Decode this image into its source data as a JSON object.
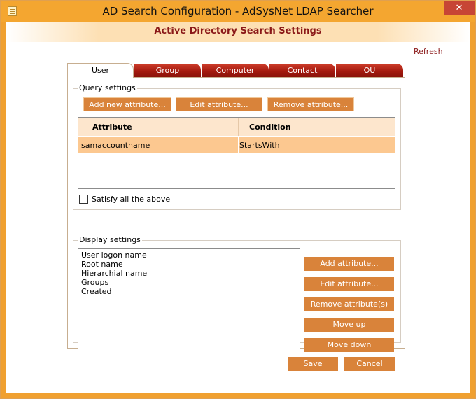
{
  "window": {
    "title": "AD Search Configuration - AdSysNet LDAP Searcher",
    "close_glyph": "✕"
  },
  "banner": {
    "title": "Active Directory Search Settings"
  },
  "refresh_link": "Refresh",
  "tabs": [
    {
      "label": "User",
      "active": true
    },
    {
      "label": "Group",
      "active": false
    },
    {
      "label": "Computer",
      "active": false
    },
    {
      "label": "Contact",
      "active": false
    },
    {
      "label": "OU",
      "active": false
    }
  ],
  "query_settings": {
    "label": "Query settings",
    "buttons": {
      "add": "Add new attribute...",
      "edit": "Edit attribute...",
      "remove": "Remove attribute..."
    },
    "grid": {
      "columns": [
        "Attribute",
        "Condition"
      ],
      "rows": [
        {
          "attribute": "samaccountname",
          "condition": "StartsWith"
        }
      ]
    },
    "satisfy_all": {
      "label": "Satisfy all the above",
      "checked": false
    }
  },
  "display_settings": {
    "label": "Display settings",
    "items": [
      "User logon name",
      "Root name",
      "Hierarchial name",
      "Groups",
      "Created"
    ],
    "buttons": {
      "add": "Add attribute...",
      "edit": "Edit attribute...",
      "remove": "Remove attribute(s)",
      "move_up": "Move up",
      "move_down": "Move down"
    }
  },
  "footer": {
    "save": "Save",
    "cancel": "Cancel"
  },
  "colors": {
    "accent": "#d9833a",
    "frame": "#f4a630",
    "header_text": "#8a1818",
    "tab_inactive": "#b02414",
    "row_selected": "#fcc890"
  }
}
